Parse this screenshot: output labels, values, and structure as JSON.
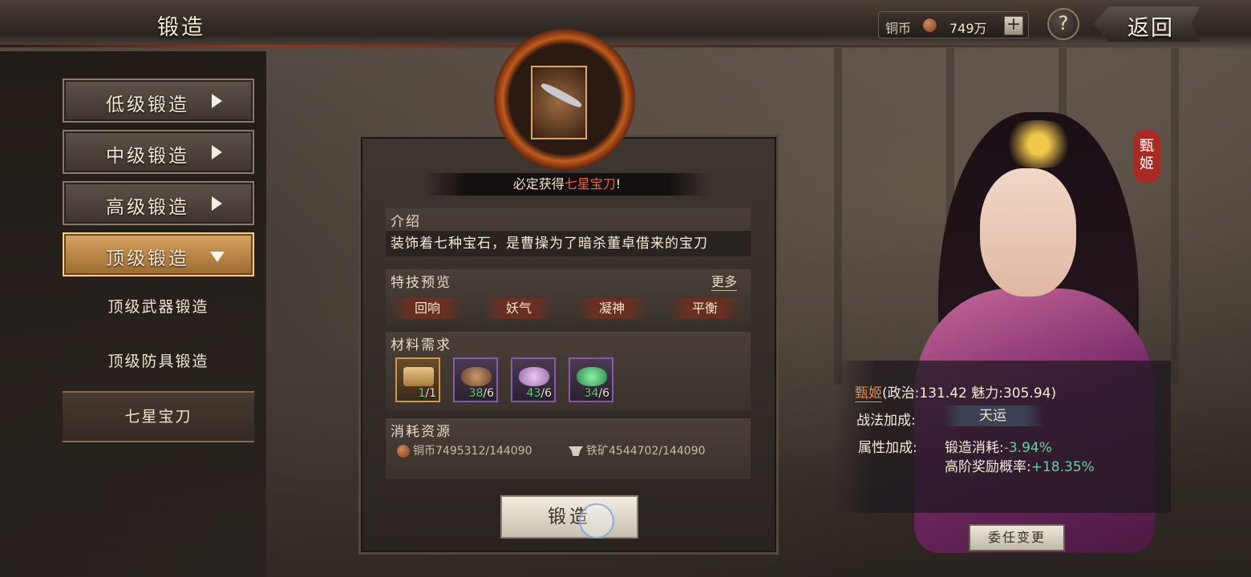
{
  "header": {
    "title": "锻造",
    "currency_label": "铜币",
    "currency_value": "749万",
    "help_label": "?",
    "back_label": "返回"
  },
  "sidebar": {
    "items": [
      {
        "label": "低级锻造",
        "expanded": false
      },
      {
        "label": "中级锻造",
        "expanded": false
      },
      {
        "label": "高级锻造",
        "expanded": false
      },
      {
        "label": "顶级锻造",
        "expanded": true
      }
    ],
    "subitems": [
      {
        "label": "顶级武器锻造"
      },
      {
        "label": "顶级防具锻造"
      },
      {
        "label": "七星宝刀",
        "selected": true
      }
    ]
  },
  "forge": {
    "banner_prefix": "必定获得",
    "banner_item": "七星宝刀",
    "banner_suffix": "!",
    "intro_title": "介绍",
    "intro_text": "装饰着七种宝石，是曹操为了暗杀董卓借来的宝刀",
    "skills_title": "特技预览",
    "more_label": "更多",
    "skills": [
      "回响",
      "妖气",
      "凝神",
      "平衡"
    ],
    "materials_title": "材料需求",
    "materials": [
      {
        "icon": "scroll-icon",
        "have": "1",
        "need": "/1"
      },
      {
        "icon": "ore-brown-icon",
        "have": "38",
        "need": "/6"
      },
      {
        "icon": "ore-pink-icon",
        "have": "43",
        "need": "/6"
      },
      {
        "icon": "ore-green-icon",
        "have": "34",
        "need": "/6"
      }
    ],
    "resources_title": "消耗资源",
    "resources": [
      {
        "icon": "copper-coin-icon",
        "text": "铜币7495312/144090"
      },
      {
        "icon": "anvil-icon",
        "text": "铁矿4544702/144090"
      }
    ],
    "forge_button": "锻造"
  },
  "character": {
    "tag": "甄姬",
    "name": "甄姬",
    "attrs": "(政治:131.42 魅力:305.94)",
    "tactic_label": "战法加成:",
    "tactic_value": "天运",
    "bonus_label": "属性加成:",
    "bonus1_label": "锻造消耗:",
    "bonus1_value": "-3.94%",
    "bonus2_label": "高阶奖励概率:",
    "bonus2_value": "+18.35%",
    "assign_button": "委任变更"
  },
  "colors": {
    "accent_gold": "#d7a460",
    "highlight_red": "#ff5a3a",
    "positive_green": "#6ad0a0"
  }
}
